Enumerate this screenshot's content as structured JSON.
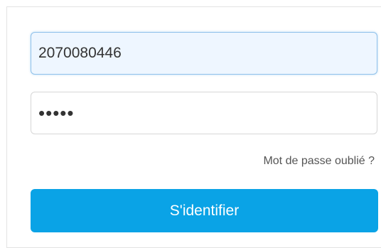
{
  "login": {
    "username_value": "2070080446",
    "password_value": "•••••",
    "forgot_label": "Mot de passe oublié ?",
    "submit_label": "S'identifier"
  },
  "colors": {
    "accent": "#0aa3e6",
    "focus_border": "#8fc1ea",
    "focus_bg": "#eef6ff"
  }
}
